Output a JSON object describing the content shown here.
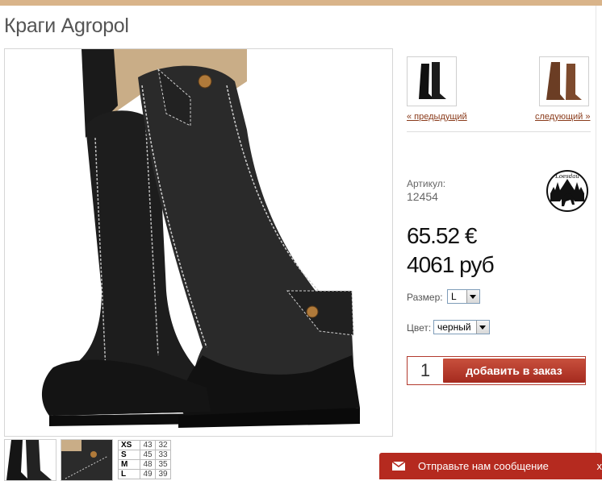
{
  "product": {
    "title": "Краги Agropol",
    "article_label": "Артикул:",
    "article_number": "12454",
    "price_eur": "65.52 €",
    "price_rub": "4061 руб"
  },
  "navigation": {
    "prev_label": "« предыдущий",
    "next_label": "следующий »"
  },
  "brand": {
    "logo_text": "Loesdau"
  },
  "options": {
    "size_label": "Размер:",
    "size_value": "L",
    "color_label": "Цвет:",
    "color_value": "черный"
  },
  "order": {
    "quantity": "1",
    "add_button_label": "добавить в заказ"
  },
  "size_chart": {
    "rows": [
      {
        "size": "XS",
        "a": "43",
        "b": "32"
      },
      {
        "size": "S",
        "a": "45",
        "b": "33"
      },
      {
        "size": "M",
        "a": "48",
        "b": "35"
      },
      {
        "size": "L",
        "a": "49",
        "b": "39"
      }
    ]
  },
  "message_widget": {
    "label": "Отправьте нам сообщение",
    "close": "x"
  },
  "colors": {
    "accent": "#b52a1f",
    "top_bar": "#d9b48a",
    "link": "#8a3b1b"
  }
}
